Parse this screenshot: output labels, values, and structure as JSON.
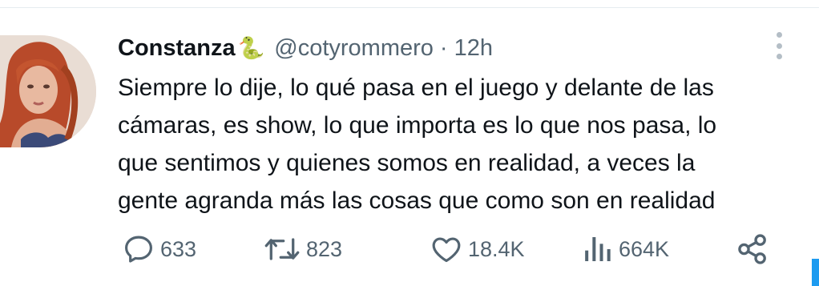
{
  "tweet": {
    "author_name": "Constanza",
    "author_emoji": "🐍",
    "handle": "@cotyrommero",
    "separator": "·",
    "time": "12h",
    "text_lines": [
      "Siempre lo dije, lo qué pasa en el juego y delante de las",
      "cámaras, es show, lo que importa es lo que nos pasa, lo",
      "que sentimos y quienes somos en realidad, a veces la",
      "gente agranda más las cosas que como son en realidad"
    ]
  },
  "actions": {
    "replies": "633",
    "retweets": "823",
    "likes": "18.4K",
    "views": "664K"
  },
  "icons": {
    "more": "more-vertical-icon",
    "reply": "reply-icon",
    "retweet": "retweet-icon",
    "like": "heart-icon",
    "views": "views-icon",
    "share": "share-icon"
  },
  "colors": {
    "text": "#0f1419",
    "muted": "#536471",
    "accent": "#1d9bf0"
  }
}
